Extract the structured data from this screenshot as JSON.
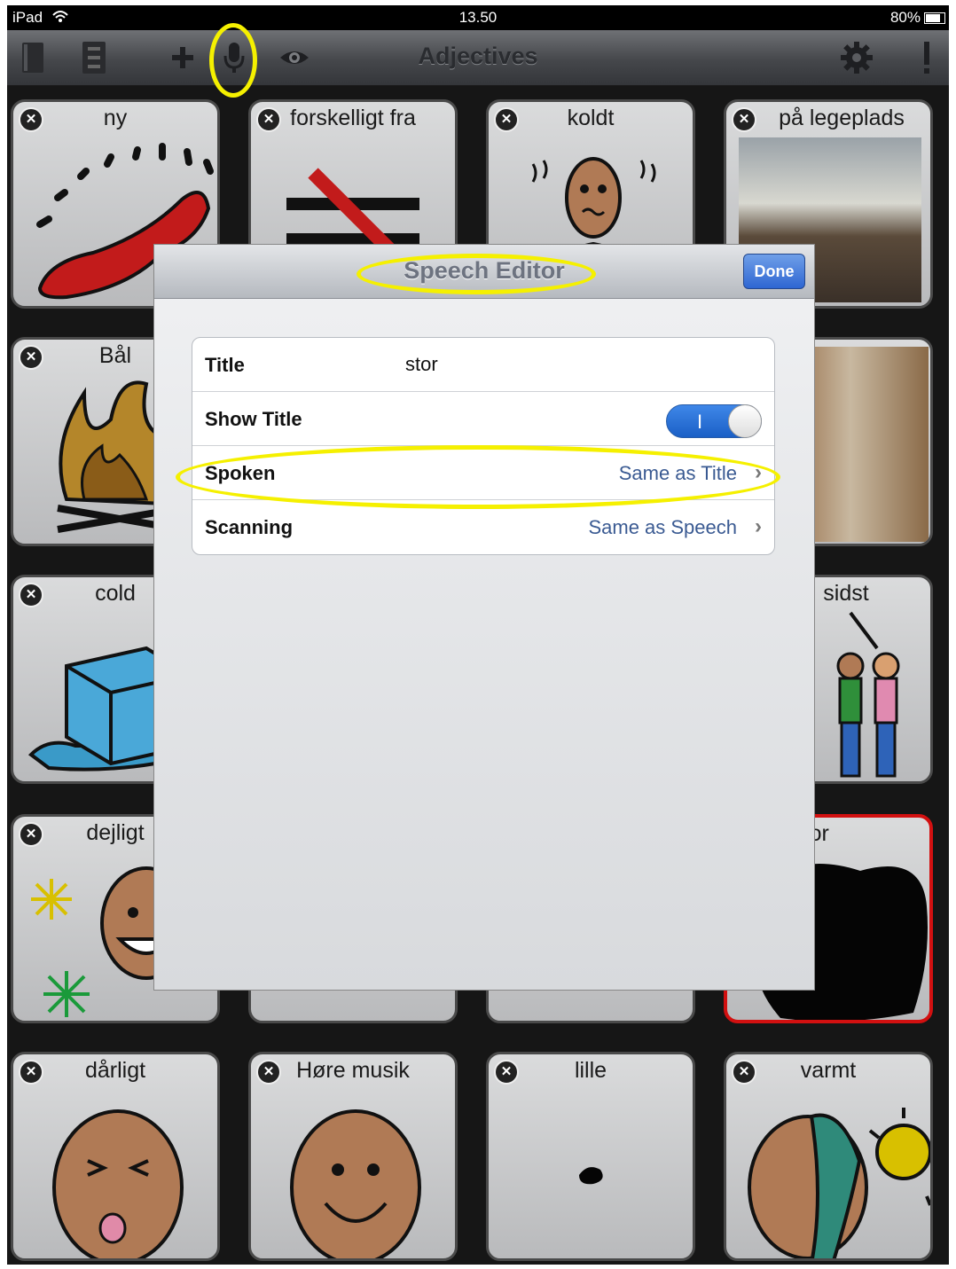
{
  "status": {
    "carrier": "iPad",
    "time": "13.50",
    "battery": "80%"
  },
  "toolbar": {
    "title": "Adjectives",
    "icons": [
      "book-icon",
      "cabinet-icon",
      "plus-icon",
      "microphone-icon",
      "eye-icon",
      "gear-icon",
      "exclamation-icon"
    ]
  },
  "tiles": [
    {
      "label": "ny",
      "icon": "red-shoe"
    },
    {
      "label": "forskelligt fra",
      "icon": "not-equal"
    },
    {
      "label": "koldt",
      "icon": "shivering-person"
    },
    {
      "label": "på legeplads",
      "icon": "playground-photo"
    },
    {
      "label": "Bål",
      "icon": "campfire"
    },
    {
      "label": "",
      "icon": "room-photo"
    },
    {
      "label": "cold",
      "icon": "ice-cube"
    },
    {
      "label": "sidst",
      "icon": "people-in-line"
    },
    {
      "label": "dejligt",
      "icon": "happy-face"
    },
    {
      "label": "stor",
      "icon": "black-blob",
      "selected": true
    },
    {
      "label": "dårligt",
      "icon": "sick-face"
    },
    {
      "label": "Høre musik",
      "icon": "smiling-face"
    },
    {
      "label": "lille",
      "icon": "small-dot"
    },
    {
      "label": "varmt",
      "icon": "hot-face-sun"
    }
  ],
  "dialog": {
    "title": "Speech Editor",
    "done_label": "Done",
    "rows": {
      "title_label": "Title",
      "title_value": "stor",
      "show_title_label": "Show Title",
      "show_title_toggle": "I",
      "spoken_label": "Spoken",
      "spoken_value": "Same as Title",
      "scanning_label": "Scanning",
      "scanning_value": "Same as Speech"
    }
  },
  "highlight_color": "#f5f000",
  "selected_tile_color": "#d21010"
}
